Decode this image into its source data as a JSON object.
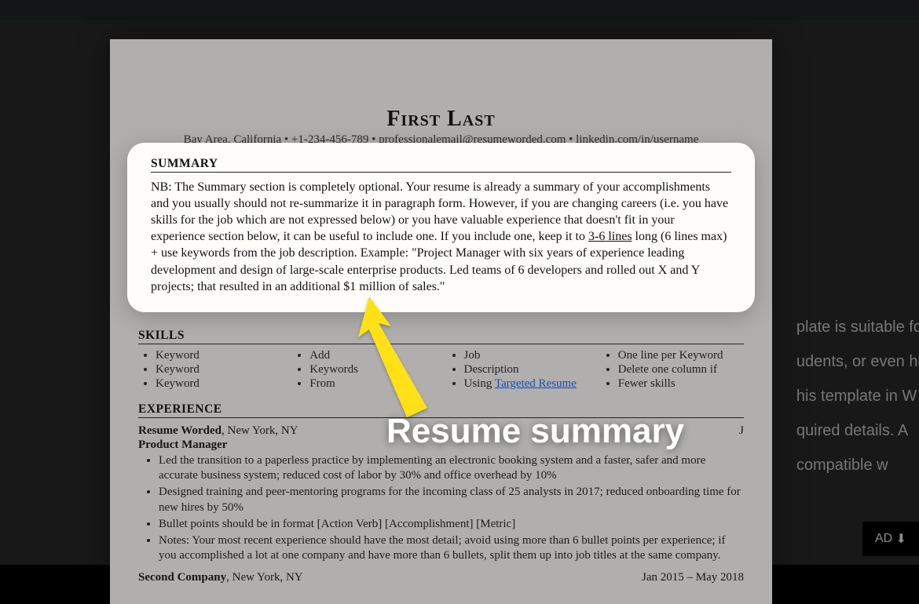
{
  "background": {
    "lines": [
      "plate is suitable fo",
      "udents, or even hi",
      "his template in W",
      "quired details. A",
      "compatible w"
    ],
    "button": "AD",
    "button_icon": "⬇"
  },
  "resume": {
    "name": "First Last",
    "contact": "Bay Area, California • +1-234-456-789 • professionalemail@resumeworded.com • linkedin.com/in/username",
    "summary_head": "SUMMARY",
    "summary_body_1": "NB: The Summary section is completely optional. Your resume is already a summary of your accomplishments and you usually should not re-summarize it in paragraph form. However, if you are changing careers (i.e. you have skills for the job which are not expressed below) or you have valuable experience that doesn't fit in your experience section below, it can be useful to include one. If you include one, keep it to ",
    "summary_lines": "3-6 lines",
    "summary_body_2": " long (6 lines max) + use keywords from the job description. Example: \"Project Manager with six years of experience leading development and design of large-scale enterprise products. Led teams of 6 developers and rolled out X and Y projects; that resulted in an additional $1 million of sales.\"",
    "skills_head": "SKILLS",
    "skills": {
      "col1": [
        "Keyword",
        "Keyword",
        "Keyword"
      ],
      "col2": [
        "Add",
        "Keywords",
        "From"
      ],
      "col3_a": "Job",
      "col3_b": "Description",
      "col3_c_pre": "Using ",
      "col3_c_link": "Targeted Resume",
      "col4": [
        "One line per Keyword",
        "Delete one column if",
        "Fewer skills"
      ]
    },
    "experience_head": "EXPERIENCE",
    "job1": {
      "company": "Resume Worded",
      "location": ", New York, NY",
      "dates_obscured": "J",
      "title": "Product Manager",
      "bullets": [
        "Led the transition to a paperless practice by implementing an electronic booking system and a faster, safer and more accurate business system; reduced cost of labor by 30% and office overhead by 10%",
        "Designed training and peer-mentoring programs for the incoming class of 25 analysts in 2017; reduced onboarding time for new hires by 50%",
        "Bullet points should be in format [Action Verb] [Accomplishment] [Metric]",
        "Notes: Your most recent experience should have the most detail; avoid using more than 6 bullet points per experience; if you accomplished a lot at one company and have more than 6 bullets, split them up into job titles at the same company."
      ]
    },
    "job2": {
      "company": "Second Company",
      "location": ", New York, NY",
      "dates": "Jan 2015 – May 2018"
    }
  },
  "annotation": "Resume summary"
}
